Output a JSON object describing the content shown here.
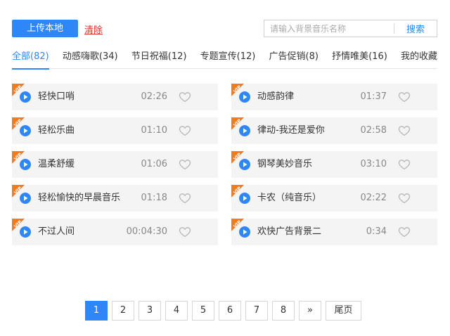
{
  "toolbar": {
    "upload_label": "上传本地",
    "clear_label": "清除"
  },
  "search": {
    "placeholder": "请输入背景音乐名称",
    "value": "",
    "button_label": "搜索"
  },
  "tabs": [
    {
      "label": "全部(82)",
      "active": true
    },
    {
      "label": "动感嗨歌(34)",
      "active": false
    },
    {
      "label": "节日祝福(12)",
      "active": false
    },
    {
      "label": "专题宣传(12)",
      "active": false
    },
    {
      "label": "广告促销(8)",
      "active": false
    },
    {
      "label": "抒情唯美(16)",
      "active": false
    },
    {
      "label": "我的收藏",
      "active": false
    }
  ],
  "badge_text": "VIP",
  "songs": [
    {
      "name": "轻快口哨",
      "duration": "02:26",
      "vip": true
    },
    {
      "name": "动感韵律",
      "duration": "01:37",
      "vip": true
    },
    {
      "name": "轻松乐曲",
      "duration": "01:10",
      "vip": true
    },
    {
      "name": "律动-我还是爱你",
      "duration": "02:58",
      "vip": true
    },
    {
      "name": "温柔舒缓",
      "duration": "01:06",
      "vip": true
    },
    {
      "name": "钢琴美妙音乐",
      "duration": "03:10",
      "vip": true
    },
    {
      "name": "轻松愉快的早晨音乐",
      "duration": "01:18",
      "vip": true
    },
    {
      "name": "卡农（纯音乐）",
      "duration": "02:22",
      "vip": true
    },
    {
      "name": "不过人间",
      "duration": "00:04:30",
      "vip": true
    },
    {
      "name": "欢快广告背景二",
      "duration": "0:34",
      "vip": true
    }
  ],
  "pagination": {
    "pages": [
      "1",
      "2",
      "3",
      "4",
      "5",
      "6",
      "7",
      "8"
    ],
    "current": "1",
    "next_label": "»",
    "last_label": "尾页"
  },
  "colors": {
    "accent": "#2f86f6",
    "danger": "#e0302b",
    "vip_badge": "#f47a22",
    "card_bg": "#f4f4f4"
  },
  "icons": {
    "play": "play-circle-icon",
    "favorite": "heart-outline-icon",
    "vip": "vip-corner-badge-icon"
  }
}
